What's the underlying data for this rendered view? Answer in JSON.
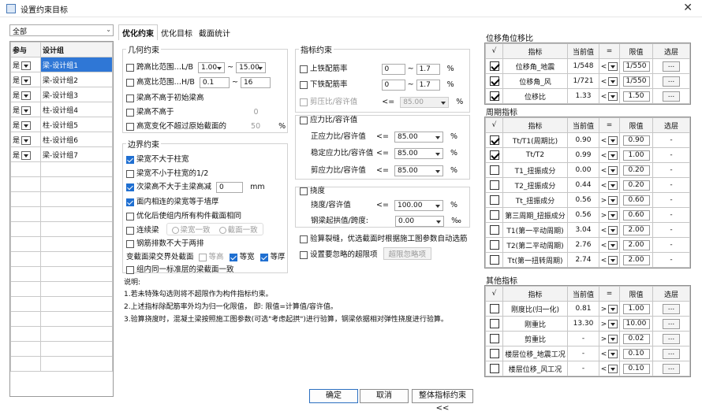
{
  "window": {
    "title": "设置约束目标",
    "close": "✕"
  },
  "left": {
    "filter": "全部",
    "headers": [
      "参与",
      "设计组"
    ],
    "rows": [
      {
        "p": "是",
        "g": "梁-设计组1",
        "sel": true
      },
      {
        "p": "是",
        "g": "梁-设计组2"
      },
      {
        "p": "是",
        "g": "梁-设计组3"
      },
      {
        "p": "是",
        "g": "柱-设计组4"
      },
      {
        "p": "是",
        "g": "柱-设计组5"
      },
      {
        "p": "是",
        "g": "柱-设计组6"
      },
      {
        "p": "是",
        "g": "梁-设计组7"
      }
    ]
  },
  "tabs": [
    "优化约束",
    "优化目标",
    "截面统计"
  ],
  "geo": {
    "legend": "几何约束",
    "r1": {
      "label": "跨高比范围…L/B",
      "min": "1.00",
      "sep": "~",
      "max": "15.00"
    },
    "r2": {
      "label": "高宽比范围…H/B",
      "min": "0.1",
      "sep": "~",
      "max": "16"
    },
    "r3": "梁高不高于初始梁高",
    "r4": {
      "label": "梁高不高于",
      "val": "0"
    },
    "r5": {
      "label": "高宽变化不超过原始截面的",
      "val": "50",
      "unit": "%"
    }
  },
  "edge": {
    "legend": "边界约束",
    "r1": "梁宽不大于柱宽",
    "r2": "梁宽不小于柱宽的1/2",
    "r3": {
      "label": "次梁高不大于主梁高减",
      "val": "0",
      "unit": "mm"
    },
    "r4": "面内相连的梁宽等于墙厚",
    "r5": "优化后使组内所有构件截面相同",
    "r6": {
      "label": "连续梁",
      "o1": "梁宽一致",
      "o2": "截面一致"
    },
    "r7": "钢筋排数不大于两排",
    "r8": {
      "label": "变截面梁交界处截面",
      "o1": "等高",
      "o2": "等宽",
      "o3": "等厚"
    },
    "r9": "组内同一标准层的梁截面一致"
  },
  "idx": {
    "legend": "指标约束",
    "r1": {
      "label": "上铁配筋率",
      "min": "0",
      "sep": "~",
      "max": "1.7",
      "unit": "%"
    },
    "r2": {
      "label": "下铁配筋率",
      "min": "0",
      "sep": "~",
      "max": "1.7",
      "unit": "%"
    },
    "r3": {
      "label": "剪压比/容许值",
      "op": "<=",
      "val": "85.00",
      "unit": "%"
    }
  },
  "stress": {
    "legend": "应力比/容许值",
    "r1": {
      "label": "正应力比/容许值",
      "op": "<=",
      "val": "85.00",
      "unit": "%"
    },
    "r2": {
      "label": "稳定应力比/容许值",
      "op": "<=",
      "val": "85.00",
      "unit": "%"
    },
    "r3": {
      "label": "剪应力比/容许值",
      "op": "<=",
      "val": "85.00",
      "unit": "%"
    }
  },
  "defl": {
    "legend": "挠度",
    "r1": {
      "label": "挠度/容许值",
      "op": "<=",
      "val": "100.00",
      "unit": "%"
    },
    "r2": {
      "label": "钢梁起拱值/跨度:",
      "val": "0.00",
      "unit": "‰"
    }
  },
  "crack": "验算裂缝，优选截面时根据施工图参数自动选筋",
  "ignore": {
    "label": "设置要忽略的超限项",
    "btn": "超限忽略项"
  },
  "notes": {
    "title": "说明:",
    "l1": "1.若未特殊勾选则将不超限作为构件指标约束。",
    "l2": "2.上述指标除配筋率外均为归一化限值，  即: 限值=计算值/容许值。",
    "l3": "3.验算挠度时，混凝土梁按照施工图参数(可选\"考虑起拱\")进行验算，钢梁依据相对弹性挠度进行验算。"
  },
  "right": {
    "hdr": [
      "√",
      "指标",
      "当前值",
      "=",
      "限值",
      "选层"
    ],
    "disp": {
      "title": "位移角位移比",
      "rows": [
        {
          "on": true,
          "name": "位移角_地震",
          "cur": "1/548",
          "op": "<",
          "lim": "1/550",
          "lay": "..."
        },
        {
          "on": true,
          "name": "位移角_风",
          "cur": "1/721",
          "op": "<",
          "lim": "1/550",
          "lay": "..."
        },
        {
          "on": true,
          "name": "位移比",
          "cur": "1.33",
          "op": "<",
          "lim": "1.50",
          "lay": "..."
        }
      ]
    },
    "period": {
      "title": "周期指标",
      "rows": [
        {
          "on": true,
          "name": "Tt/T1(周期比)",
          "cur": "0.90",
          "op": "<",
          "lim": "0.90",
          "lay": "-"
        },
        {
          "on": true,
          "name": "Tt/T2",
          "cur": "0.99",
          "op": "<",
          "lim": "1.00",
          "lay": "-"
        },
        {
          "on": false,
          "name": "T1_扭振成分",
          "cur": "0.00",
          "op": "<",
          "lim": "0.20",
          "lay": "-"
        },
        {
          "on": false,
          "name": "T2_扭振成分",
          "cur": "0.44",
          "op": "<",
          "lim": "0.20",
          "lay": "-"
        },
        {
          "on": false,
          "name": "Tt_扭振成分",
          "cur": "0.56",
          "op": ">",
          "lim": "0.60",
          "lay": "-"
        },
        {
          "on": false,
          "name": "第三周期_扭振成分",
          "cur": "0.56",
          "op": ">",
          "lim": "0.60",
          "lay": "-"
        },
        {
          "on": false,
          "name": "T1(第一平动周期)",
          "cur": "3.04",
          "op": "<",
          "lim": "2.00",
          "lay": "-"
        },
        {
          "on": false,
          "name": "T2(第二平动周期)",
          "cur": "2.76",
          "op": "<",
          "lim": "2.00",
          "lay": "-"
        },
        {
          "on": false,
          "name": "Tt(第一扭转周期)",
          "cur": "2.74",
          "op": "<",
          "lim": "2.00",
          "lay": "-"
        }
      ]
    },
    "other": {
      "title": "其他指标",
      "rows": [
        {
          "on": false,
          "name": "刚度比(归一化)",
          "cur": "0.81",
          "op": ">",
          "lim": "1.00",
          "lay": "..."
        },
        {
          "on": false,
          "name": "刚重比",
          "cur": "13.30",
          "op": ">",
          "lim": "10.00",
          "lay": "..."
        },
        {
          "on": false,
          "name": "剪重比",
          "cur": "-",
          "op": ">",
          "lim": "0.02",
          "lay": "..."
        },
        {
          "on": false,
          "name": "楼层位移_地震工况",
          "cur": "-",
          "op": "<",
          "lim": "0.10",
          "lay": "..."
        },
        {
          "on": false,
          "name": "楼层位移_风工况",
          "cur": "-",
          "op": "<",
          "lim": "0.10",
          "lay": "..."
        }
      ]
    }
  },
  "buttons": {
    "ok": "确定",
    "cancel": "取消",
    "whole": "整体指标约束<<"
  }
}
